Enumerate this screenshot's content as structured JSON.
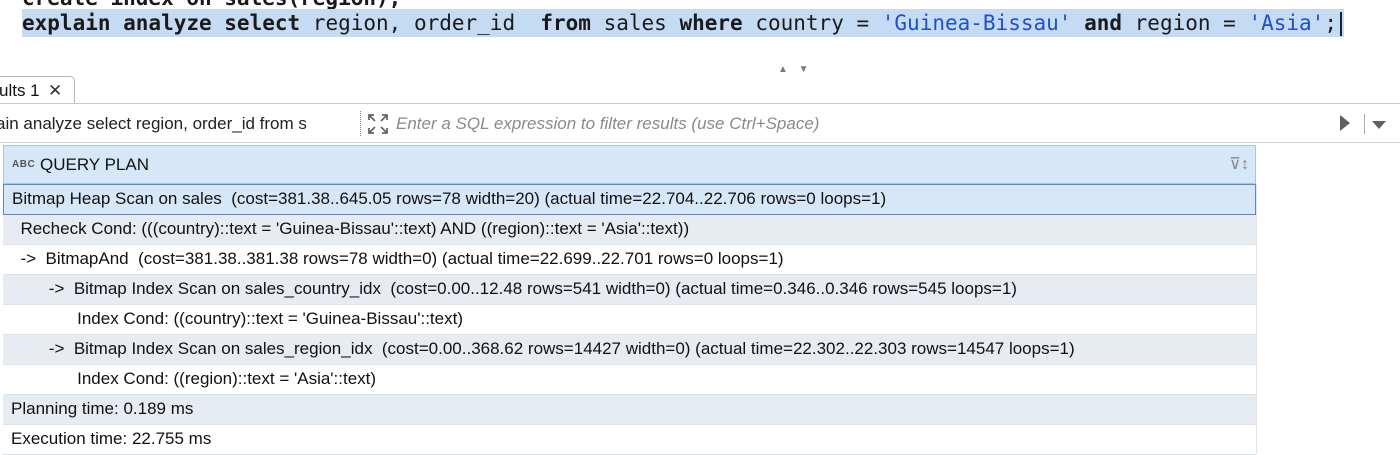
{
  "editor": {
    "previous_line": "create index on sales(region);",
    "current_line_parts": [
      {
        "text": "explain analyze select",
        "kind": "keyword"
      },
      {
        "text": " region, order_id  ",
        "kind": "plain"
      },
      {
        "text": "from",
        "kind": "keyword"
      },
      {
        "text": " sales ",
        "kind": "plain"
      },
      {
        "text": "where",
        "kind": "keyword"
      },
      {
        "text": " country = ",
        "kind": "plain"
      },
      {
        "text": "'Guinea-Bissau'",
        "kind": "string"
      },
      {
        "text": " ",
        "kind": "plain"
      },
      {
        "text": "and",
        "kind": "keyword"
      },
      {
        "text": " region = ",
        "kind": "plain"
      },
      {
        "text": "'Asia'",
        "kind": "string"
      },
      {
        "text": ";",
        "kind": "plain"
      }
    ],
    "splitter_glyph": "▲ ▼"
  },
  "results": {
    "tab_label": "ults 1",
    "tab_close_glyph": "✕",
    "query_summary": "ain analyze select region, order_id from s",
    "filter_placeholder": "Enter a SQL expression to filter results (use Ctrl+Space)"
  },
  "grid": {
    "column_type_icon": "ABC",
    "column_header": "QUERY PLAN",
    "sort_glyph": "⊽↕",
    "rows": [
      "Bitmap Heap Scan on sales  (cost=381.38..645.05 rows=78 width=20) (actual time=22.704..22.706 rows=0 loops=1)",
      "  Recheck Cond: (((country)::text = 'Guinea-Bissau'::text) AND ((region)::text = 'Asia'::text))",
      "  ->  BitmapAnd  (cost=381.38..381.38 rows=78 width=0) (actual time=22.699..22.701 rows=0 loops=1)",
      "        ->  Bitmap Index Scan on sales_country_idx  (cost=0.00..12.48 rows=541 width=0) (actual time=0.346..0.346 rows=545 loops=1)",
      "              Index Cond: ((country)::text = 'Guinea-Bissau'::text)",
      "        ->  Bitmap Index Scan on sales_region_idx  (cost=0.00..368.62 rows=14427 width=0) (actual time=22.302..22.303 rows=14547 loops=1)",
      "              Index Cond: ((region)::text = 'Asia'::text)",
      "Planning time: 0.189 ms",
      "Execution time: 22.755 ms"
    ],
    "selected_row": 0
  },
  "colors": {
    "selection": "#c5daf3",
    "header": "#d6e7f8",
    "alt_row": "#e7ecf3",
    "string": "#2050c8"
  }
}
